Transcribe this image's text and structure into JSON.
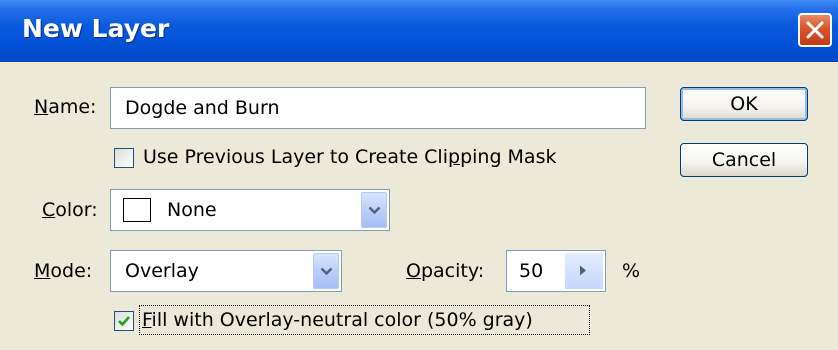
{
  "window": {
    "title": "New Layer"
  },
  "name_field": {
    "label_mnemonic": "N",
    "label_rest": "ame:",
    "value": "Dogde and Burn"
  },
  "clipping_mask": {
    "label_pre": "Use Previous Layer to Create Cli",
    "label_mnemonic": "p",
    "label_post": "ping Mask",
    "checked": false
  },
  "color_field": {
    "label_mnemonic": "C",
    "label_rest": "olor:",
    "value": "None"
  },
  "mode_field": {
    "label_mnemonic": "M",
    "label_rest": "ode:",
    "value": "Overlay"
  },
  "opacity_field": {
    "label_mnemonic": "O",
    "label_rest": "pacity:",
    "value": "50",
    "unit": "%"
  },
  "fill_neutral": {
    "label_mnemonic": "F",
    "label_rest": "ill with Overlay-neutral color (50% gray)",
    "checked": true
  },
  "buttons": {
    "ok": "OK",
    "cancel": "Cancel"
  },
  "icons": {
    "close": "close-icon",
    "dropdown": "chevron-down-icon",
    "slider": "triangle-right-icon",
    "check": "checkmark-icon"
  },
  "colors": {
    "titlebar": "#0452d6",
    "dialog_bg": "#ece9d8",
    "close_button": "#d9552e",
    "checkmark": "#21a121"
  }
}
